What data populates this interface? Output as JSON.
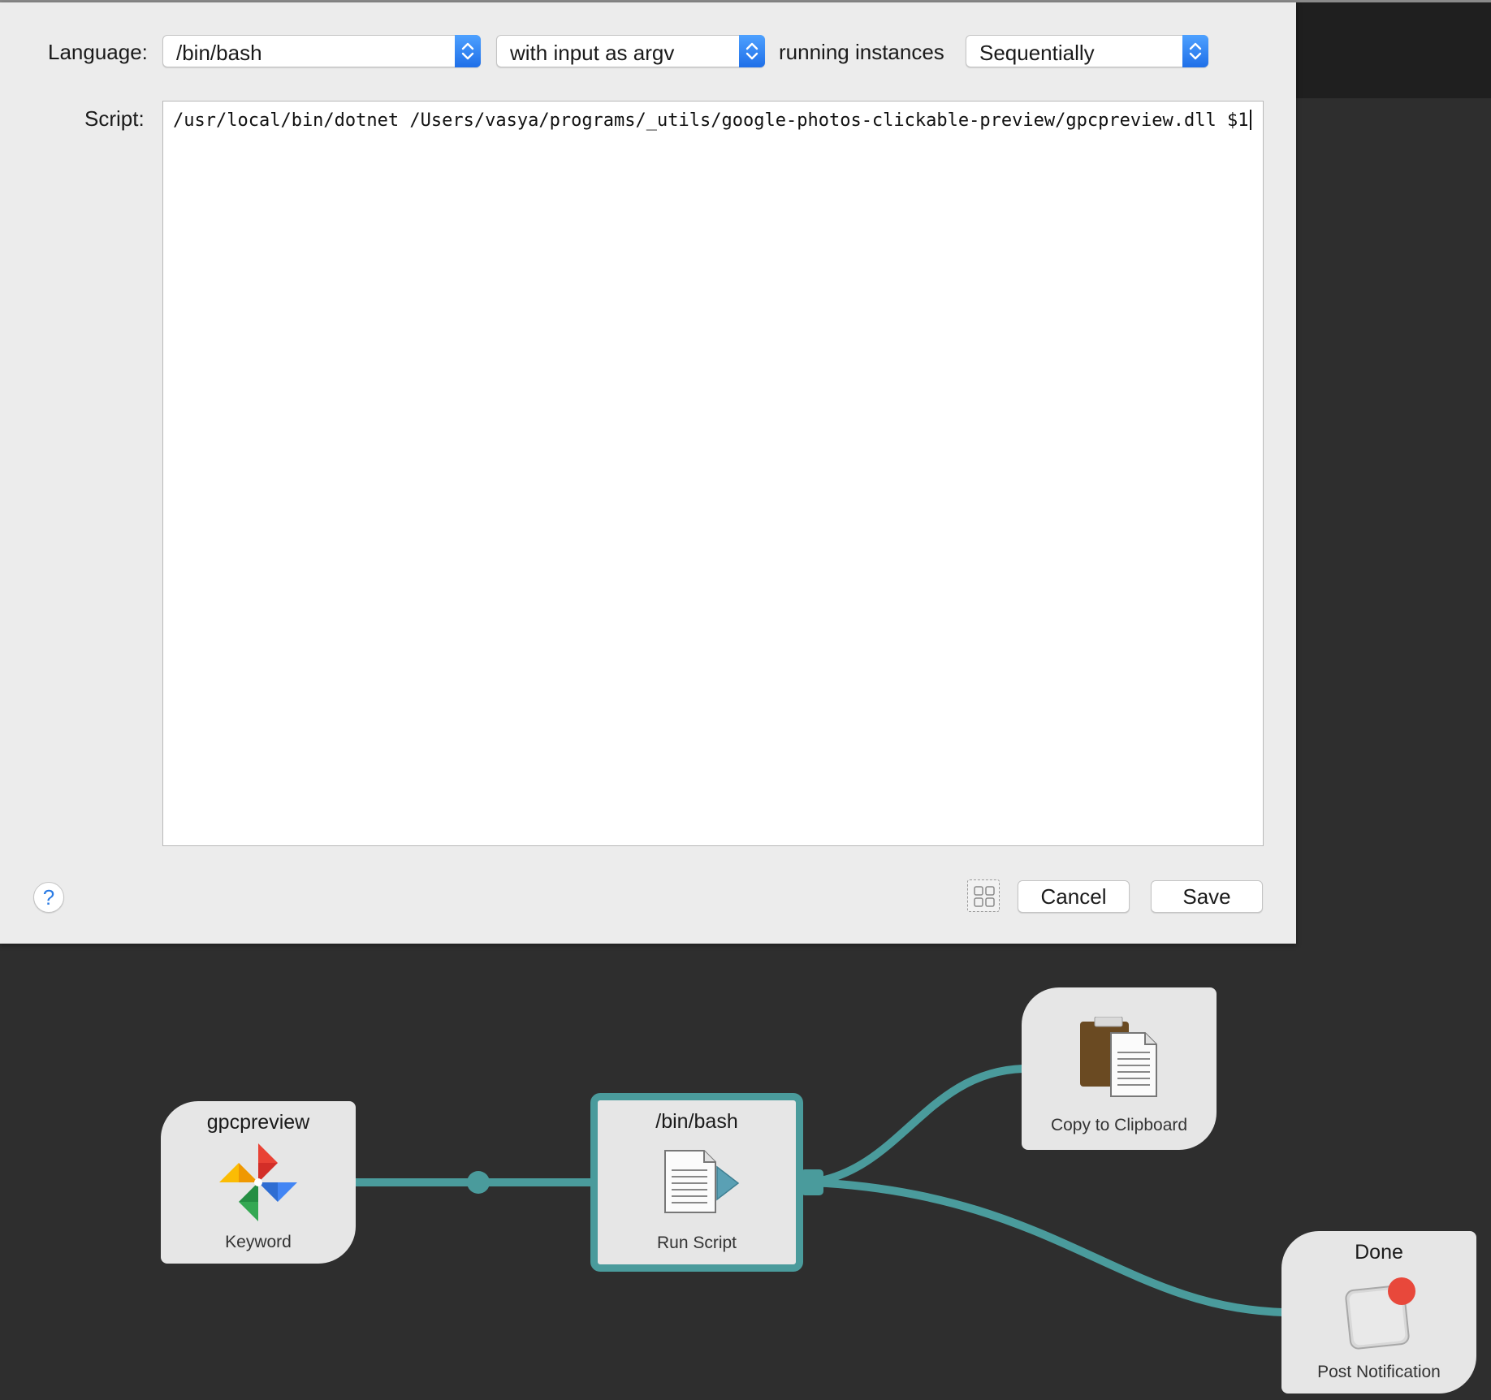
{
  "sheet": {
    "language_label": "Language:",
    "language_value": "/bin/bash",
    "input_mode_value": "with input as argv",
    "running_label": "running instances",
    "running_value": "Sequentially",
    "script_label": "Script:",
    "script_text": "/usr/local/bin/dotnet /Users/vasya/programs/_utils/google-photos-clickable-preview/gpcpreview.dll $1",
    "help_label": "?",
    "cancel_label": "Cancel",
    "save_label": "Save"
  },
  "workflow": {
    "nodes": [
      {
        "title": "gpcpreview",
        "label": "Keyword",
        "icon": "google-photos-pinwheel-icon"
      },
      {
        "title": "/bin/bash",
        "label": "Run Script",
        "icon": "run-script-icon"
      },
      {
        "title": "",
        "label": "Copy to Clipboard",
        "icon": "clipboard-icon"
      },
      {
        "title": "Done",
        "label": "Post Notification",
        "icon": "notification-icon"
      }
    ],
    "wire_color": "#4a9b9c"
  }
}
